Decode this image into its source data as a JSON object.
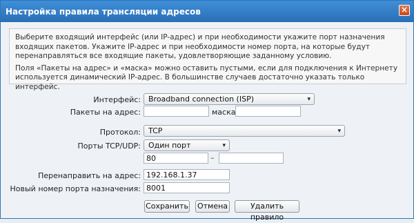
{
  "dialog": {
    "title": "Настройка правила трансляции адресов",
    "close_glyph": "×"
  },
  "info": {
    "paragraph1": "Выберите входящий интерфейс (или IP-адрес) и при необходимости укажите порт назначения входящих пакетов. Укажите IP-адрес и при необходимости номер порта, на которые будут перенаправляться все входящие пакеты, удовлетворяющие заданному условию.",
    "paragraph2": "Поля «Пакеты на адрес» и «маска» можно оставить пустыми, если для подключения к Интернету используется динамический IP-адрес. В большинстве случаев достаточно указать только интерфейс."
  },
  "form": {
    "interface_label": "Интерфейс:",
    "interface_value": "Broadband connection (ISP)",
    "packets_to_label": "Пакеты на адрес:",
    "packets_to_value": "",
    "mask_label": "маска:",
    "mask_value": "",
    "protocol_label": "Протокол:",
    "protocol_value": "TCP",
    "ports_label": "Порты TCP/UDP:",
    "ports_mode_value": "Один порт",
    "port_from_value": "80",
    "port_range_dash": "–",
    "port_to_value": "",
    "redirect_to_label": "Перенаправить на адрес:",
    "redirect_to_value": "192.168.1.37",
    "dest_port_label": "Новый номер порта назначения:",
    "dest_port_value": "8001"
  },
  "buttons": {
    "save": "Сохранить",
    "cancel": "Отмена",
    "delete": "Удалить правило"
  },
  "icons": {
    "chevron": "▾"
  }
}
